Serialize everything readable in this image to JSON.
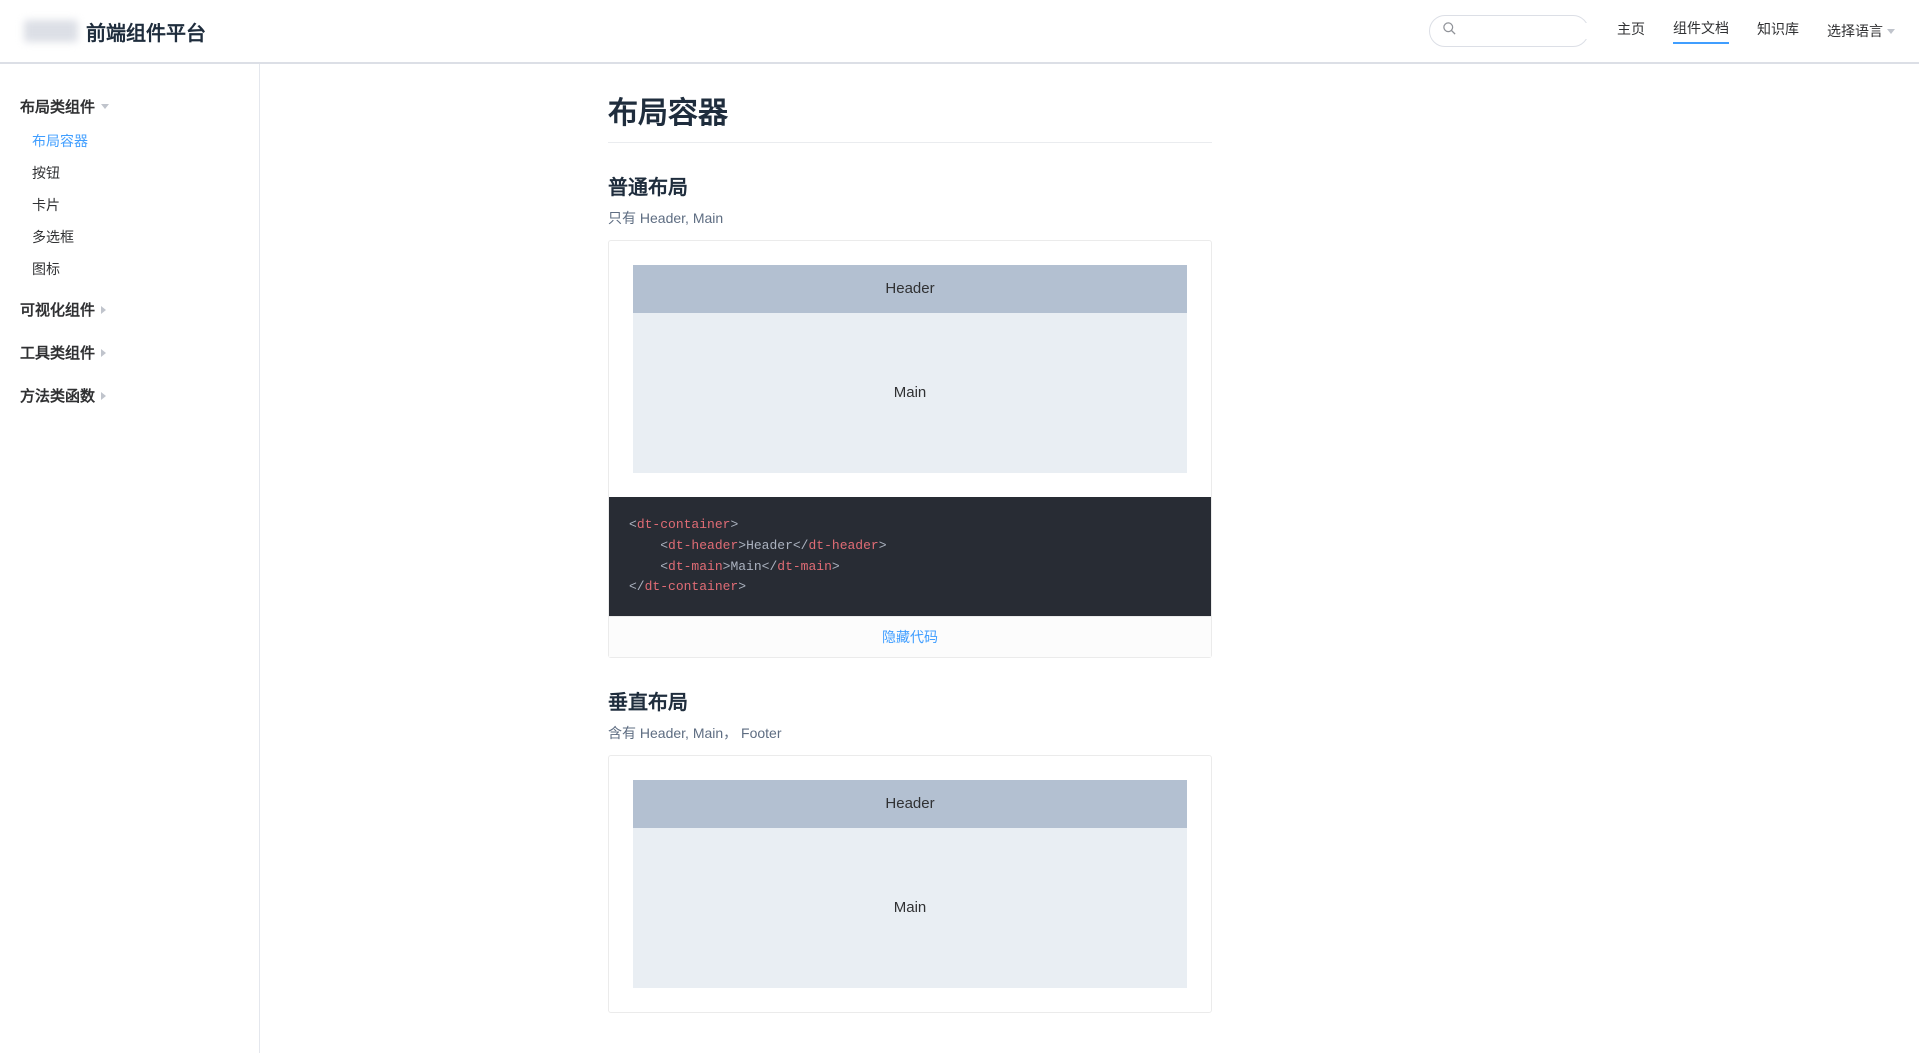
{
  "header": {
    "site_title": "前端组件平台",
    "nav": {
      "home": "主页",
      "docs": "组件文档",
      "kb": "知识库",
      "lang": "选择语言"
    }
  },
  "sidebar": {
    "groups": [
      {
        "title": "布局类组件",
        "expanded": true,
        "items": [
          "布局容器",
          "按钮",
          "卡片",
          "多选框",
          "图标"
        ],
        "activeIndex": 0
      },
      {
        "title": "可视化组件",
        "expanded": false
      },
      {
        "title": "工具类组件",
        "expanded": false
      },
      {
        "title": "方法类函数",
        "expanded": false
      }
    ]
  },
  "page": {
    "title": "布局容器",
    "sections": [
      {
        "heading": "普通布局",
        "desc": "只有 Header, Main",
        "preview": {
          "header": "Header",
          "main": "Main"
        },
        "code_tokens": [
          [
            "punc",
            "<"
          ],
          [
            "tag",
            "dt-container"
          ],
          [
            "punc",
            ">"
          ],
          [
            "nl",
            ""
          ],
          [
            "indent",
            "    "
          ],
          [
            "punc",
            "<"
          ],
          [
            "tag",
            "dt-header"
          ],
          [
            "punc",
            ">"
          ],
          [
            "text",
            "Header"
          ],
          [
            "punc",
            "</"
          ],
          [
            "tag",
            "dt-header"
          ],
          [
            "punc",
            ">"
          ],
          [
            "nl",
            ""
          ],
          [
            "indent",
            "    "
          ],
          [
            "punc",
            "<"
          ],
          [
            "tag",
            "dt-main"
          ],
          [
            "punc",
            ">"
          ],
          [
            "text",
            "Main"
          ],
          [
            "punc",
            "</"
          ],
          [
            "tag",
            "dt-main"
          ],
          [
            "punc",
            ">"
          ],
          [
            "nl",
            ""
          ],
          [
            "punc",
            "</"
          ],
          [
            "tag",
            "dt-container"
          ],
          [
            "punc",
            ">"
          ]
        ],
        "toggle_text": "隐藏代码"
      },
      {
        "heading": "垂直布局",
        "desc": "含有 Header, Main， Footer",
        "preview": {
          "header": "Header",
          "main": "Main"
        }
      }
    ]
  }
}
